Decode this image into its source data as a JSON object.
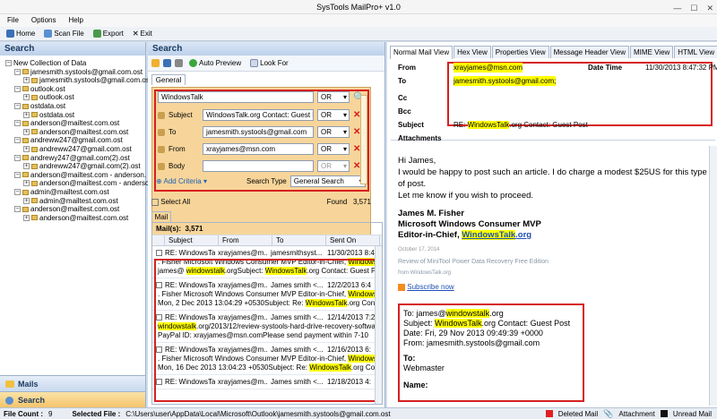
{
  "window": {
    "title": "SysTools MailPro+ v1.0",
    "minimize": "—",
    "maximize": "☐",
    "close": "✕"
  },
  "menu": [
    "File",
    "Options",
    "Help"
  ],
  "toolbar": {
    "home": "Home",
    "scan_file": "Scan File",
    "export": "Export",
    "exit": "Exit"
  },
  "sidebar": {
    "title": "Search",
    "tree": [
      {
        "label": "New Collection of Data",
        "exp": "−",
        "folder": false
      },
      {
        "label": "jamesmith.systools@gmail.com.ost",
        "exp": "−",
        "folder": true
      },
      {
        "label": "jamesmith.systools@gmail.com.ost",
        "exp": "+",
        "folder": true
      },
      {
        "label": "outlook.ost",
        "exp": "−",
        "folder": true
      },
      {
        "label": "outlook.ost",
        "exp": "+",
        "folder": true
      },
      {
        "label": "ostdata.ost",
        "exp": "−",
        "folder": true
      },
      {
        "label": "ostdata.ost",
        "exp": "+",
        "folder": true
      },
      {
        "label": "anderson@mailtest.com.ost",
        "exp": "−",
        "folder": true
      },
      {
        "label": "anderson@mailtest.com.ost",
        "exp": "+",
        "folder": true
      },
      {
        "label": "andreww247@gmail.com.ost",
        "exp": "−",
        "folder": true
      },
      {
        "label": "andreww247@gmail.com.ost",
        "exp": "+",
        "folder": true
      },
      {
        "label": "andrewy247@gmail.com(2).ost",
        "exp": "−",
        "folder": true
      },
      {
        "label": "andreww247@gmail.com(2).ost",
        "exp": "+",
        "folder": true
      },
      {
        "label": "anderson@mailtest.com - anderson.",
        "exp": "−",
        "folder": true
      },
      {
        "label": "anderson@mailtest.com - anderson.",
        "exp": "+",
        "folder": true
      },
      {
        "label": "admin@mailtest.com.ost",
        "exp": "−",
        "folder": true
      },
      {
        "label": "admin@mailtest.com.ost",
        "exp": "+",
        "folder": true
      },
      {
        "label": "anderson@mailtest.com.ost",
        "exp": "−",
        "folder": true
      },
      {
        "label": "anderson@mailtest.com.ost",
        "exp": "+",
        "folder": true
      }
    ],
    "nav_mails": "Mails",
    "nav_search": "Search"
  },
  "search": {
    "title": "Search",
    "auto_preview": "Auto Preview",
    "look_for": "Look For",
    "general_tab": "General",
    "keyword": "WindowsTalk",
    "keyword_op": "OR",
    "criteria": [
      {
        "label": "Subject",
        "value": "WindowsTalk.org Contact: Guest Pos",
        "op": "OR"
      },
      {
        "label": "To",
        "value": "jamesmith.systools@gmail.com",
        "op": "OR"
      },
      {
        "label": "From",
        "value": "xrayjames@msn.com",
        "op": "OR"
      },
      {
        "label": "Body",
        "value": "",
        "op": "OR"
      }
    ],
    "add_criteria": "Add Criteria",
    "search_type_label": "Search Type",
    "search_type": "General Search",
    "select_all": "Select All",
    "found_label": "Found",
    "found_count": "3,571"
  },
  "mail": {
    "tab": "Mail",
    "count_label": "Mail(s):",
    "count": "3,571",
    "columns": [
      "Subject",
      "From",
      "To",
      "Sent On"
    ],
    "rows": [
      {
        "subject": "RE: WindowsTalk...",
        "from": "xrayjames@m...",
        "to": "jamesmithsyst...",
        "sent": "11/30/2013 8:4",
        "body1_a": ". Fisher Microsoft Windows Consumer MVP Editor-in-Chief, ",
        "body1_hl": "WindowsTalk",
        "body1_b": ".orgTo:",
        "body2_a": "james@ ",
        "body2_hl": "windowstalk",
        "body2_b": ".orgSubject: ",
        "body2_hl2": "WindowsTalk",
        "body2_c": ".org Contact: Guest PostDate: Fri,"
      },
      {
        "subject": "RE: WindowsTalk...",
        "from": "xrayjames@m...",
        "to": "James smith <...",
        "sent": "12/2/2013 6:4",
        "body1_a": ". Fisher Microsoft Windows Consumer MVP Editor-in-Chief, ",
        "body1_hl": "WindowsTalk",
        "body1_b": ".orgDate:",
        "body2_a": "Mon, 2 Dec 2013 13:04:29 +0530Subject: Re: ",
        "body2_hl": "WindowsTalk",
        "body2_b": ".org Contact: Guest Post",
        "body2_hl2": "",
        "body2_c": ""
      },
      {
        "subject": "RE: WindowsTalk...",
        "from": "xrayjames@m...",
        "to": "James smith <...",
        "sent": "12/14/2013 7:2",
        "body1_a": "",
        "body1_hl": "windowstalk",
        "body1_b": ".org/2013/12/review-systools-hard-drive-recovery-software/My",
        "body2_a": "PayPal ID: xrayjames@msn.comPlease send payment within 7-10",
        "body2_hl": "",
        "body2_b": "",
        "body2_hl2": "",
        "body2_c": ""
      },
      {
        "subject": "RE: WindowsTalk...",
        "from": "xrayjames@m...",
        "to": "James smith <...",
        "sent": "12/16/2013 6:",
        "body1_a": ". Fisher Microsoft Windows Consumer MVP Editor-in-Chief, ",
        "body1_hl": "WindowsTalk",
        "body1_b": ".orgDate:",
        "body2_a": "Mon, 16 Dec 2013 13:04:23 +0530Subject: Re: ",
        "body2_hl": "WindowsTalk",
        "body2_b": ".org Contact: Guest",
        "body2_hl2": "",
        "body2_c": ""
      },
      {
        "subject": "RE: WindowsTalk...",
        "from": "xrayjames@m...",
        "to": "James smith <...",
        "sent": "12/18/2013 4:",
        "body1_a": "",
        "body1_hl": "",
        "body1_b": "",
        "body2_a": "",
        "body2_hl": "",
        "body2_b": "",
        "body2_hl2": "",
        "body2_c": ""
      }
    ]
  },
  "viewer": {
    "tabs": [
      "Normal Mail View",
      "Hex View",
      "Properties View",
      "Message Header View",
      "MIME View",
      "HTML View",
      "RT"
    ],
    "from_label": "From",
    "from": "xrayjames@msn.com",
    "datetime_label": "Date Time",
    "datetime": "11/30/2013 8:47:32 PM",
    "to_label": "To",
    "to": "jamesmith.systools@gmail.com;",
    "cc_label": "Cc",
    "bcc_label": "Bcc",
    "subject_label": "Subject",
    "subject_a": "RE: ",
    "subject_hl": "WindowsTalk",
    "subject_b": ".org Contact: Guest Post",
    "attachments_label": "Attachments",
    "body_greeting": "Hi James,",
    "body_line1": "I would be happy to post such an article. I do charge a modest $25US for this type",
    "body_line2": "of post.",
    "body_line3": "Let me know if you wish to proceed.",
    "sig_name": "James M. Fisher",
    "sig_title": "Microsoft Windows Consumer MVP",
    "sig_role": "Editor-in-Chief, ",
    "sig_site": "WindowsTalk",
    "sig_site_b": ".org",
    "sig_date": "October 17, 2014",
    "sig_post": "Review of MiniTool Power Data Recovery Free Edition",
    "sig_from": "from",
    "sig_from_site": "WindowsTalk.org",
    "subscribe": "Subscribe now",
    "q_to_a": "To: james@",
    "q_to_hl": "windowstalk",
    "q_to_b": ".org",
    "q_subj_a": "Subject: ",
    "q_subj_hl": "WindowsTalk",
    "q_subj_b": ".org Contact: Guest Post",
    "q_date": "Date: Fri, 29 Nov 2013 09:49:39 +0000",
    "q_from": "From: jamesmith.systools@gmail.com",
    "q_to2": "To:",
    "q_webmaster": "Webmaster",
    "q_name": "Name:"
  },
  "status": {
    "file_count_label": "File Count :",
    "file_count": "9",
    "selected_label": "Selected File :",
    "selected_path": "C:\\Users\\user\\AppData\\Local\\Microsoft\\Outlook\\jamesmith.systools@gmail.com.ost",
    "deleted": "Deleted Mail",
    "attachment": "Attachment",
    "unread": "Unread Mail",
    "colors": {
      "deleted": "#e02020",
      "unread": "#111111"
    }
  }
}
